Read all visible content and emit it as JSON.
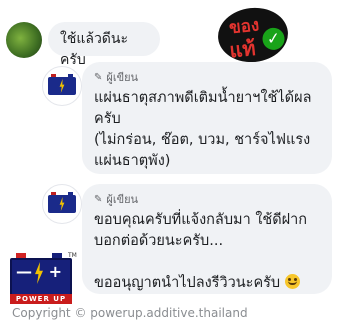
{
  "comments": [
    {
      "text": "ใช้แล้วดีนะครับ"
    },
    {
      "author_tag": "ผู้เขียน",
      "text": "แผ่นธาตุสภาพดีเติมน้ำยาฯใช้ได้ผล\nครับ\n(ไม่กร่อน, ช๊อต, บวม, ชาร์จไฟแรง\nแผ่นธาตุพัง)"
    },
    {
      "author_tag": "ผู้เขียน",
      "text": "ขอบคุณครับที่แจ้งกลับมา ใช้ดีฝาก\nบอกต่อด้วยนะครับ...\n\nขออนุญาตนำไปลงรีวิวนะครับ"
    }
  ],
  "stamp": {
    "line1": "ของ",
    "line2": "แท้"
  },
  "logo": {
    "brand": "POWER UP",
    "signs": [
      "—",
      "+"
    ],
    "tm": "TM"
  },
  "copyright": "Copyright © powerup.additive.thailand",
  "colors": {
    "bubble": "#f0f2f5",
    "battery_blue": "#16207a",
    "battery_red": "#c91c1c",
    "bolt": "#f2c200"
  },
  "icons": {
    "author_tag_icon": "pen-icon",
    "emoji": "smile-emoji-icon"
  }
}
